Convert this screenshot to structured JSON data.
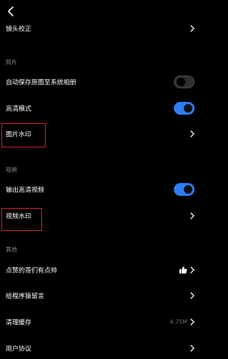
{
  "header": {
    "back_icon": "chevron-left-icon"
  },
  "rows": {
    "lens": {
      "label": "镜头校正"
    },
    "save_original": {
      "label": "自动保存原图至系统相册"
    },
    "hd_mode": {
      "label": "高清模式"
    },
    "photo_watermark": {
      "label": "图片水印"
    },
    "output_hd": {
      "label": "输出高清视频"
    },
    "video_watermark": {
      "label": "视频水印"
    },
    "like": {
      "label": "点赞的哥们有点帅"
    },
    "message": {
      "label": "给程序猿留言"
    },
    "clear_cache": {
      "label": "清理缓存",
      "value": "4.75M"
    },
    "user_agreement": {
      "label": "用户协议"
    }
  },
  "sections": {
    "photo": "照片",
    "video": "视频",
    "other": "其他"
  },
  "toggles": {
    "save_original": false,
    "hd_mode": true,
    "output_hd": true
  },
  "colors": {
    "background": "#000000",
    "accent": "#2e7cf6",
    "highlight": "#e3212a",
    "section_text": "#8b8b8b"
  }
}
